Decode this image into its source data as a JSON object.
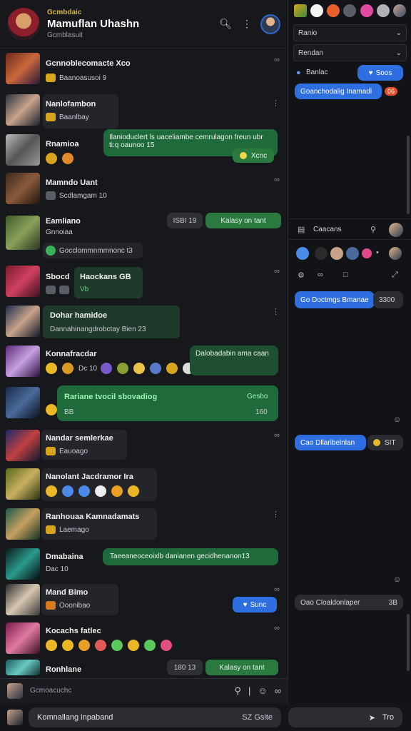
{
  "header": {
    "kicker": "Gcmbdaic",
    "title": "Mamuflan Uhashn",
    "subtitle": "Gcmblasuit",
    "search_icon": "search-icon",
    "more_icon": "more-icon"
  },
  "chats": [
    {
      "title": "Gcnnoblecomacte Xco",
      "sub": "Baanoasusoi 9",
      "badge": "gold"
    },
    {
      "title": "Nanlofambon",
      "sub": "Baanlbay",
      "badge": "gold"
    },
    {
      "title": "Rnamioa",
      "bubble": "Ilanioduclert ls uaceliambe cemrulagon freun ubr ti:q oaunoo 15",
      "pill": "Xcnc"
    },
    {
      "title": "Mamndo Uant",
      "sub": "Scdlamgam 10"
    },
    {
      "title": "Eamliano",
      "sub": "Gnnoiaa",
      "time": "ISBI 19",
      "pill": "Kalasy on tant",
      "sub2": "Gocclommnmmnonc t3"
    },
    {
      "title": "Sbocd",
      "card_title": "Haockans GB",
      "card_sub": "Vb"
    },
    {
      "title": "Dohar hamidoe",
      "sub": "Dannahinangdrobctay Bien 23"
    },
    {
      "title": "Konnafracdar",
      "sub": "Dc 10",
      "bubble": "Dalobadabin ama caan"
    },
    {
      "title": "Rariane tvocil sbovadiog",
      "bubble_right": "Gesbo",
      "sub": "BB",
      "time": "160"
    },
    {
      "title": "Nandar semlerkae",
      "sub": "Eauoago"
    },
    {
      "title": "Nanolant Jacdramor Ira",
      "sub": ""
    },
    {
      "title": "Ranhouaa Kamnadamats",
      "sub": "Laemago"
    },
    {
      "title": "Dmabaina",
      "sub": "Dac 10",
      "bubble": "Taeeaneoceoixlb danianen gecidhenanon13"
    },
    {
      "title": "Mand Bimo",
      "sub": "Ooonibao",
      "pill": "Sunc"
    },
    {
      "title": "Kocachs fatlec",
      "sub": ""
    },
    {
      "title": "Ronhlane",
      "time": "180 13",
      "pill": "Kalasy on tant"
    }
  ],
  "composer": {
    "placeholder": "Gcmoacuchc",
    "message": "Komnallang inpaband",
    "char_count": "SZ Gsite",
    "right_hint": "Tro"
  },
  "right": {
    "select1": "Ranio",
    "select2": "Rendan",
    "status_label": "Banlac",
    "status_pill": "Soos",
    "message1": "Goanchodalig Inamadl",
    "badge1": "06",
    "section_label": "Caacans",
    "message2": "Go Doctmgs Bmanae",
    "time2": "3300",
    "message3": "Cao Dllaribelnlan",
    "time3": "SIT",
    "message4": "Oao Cloaldonlaper",
    "time4": "3B"
  },
  "colors": {
    "accent_blue": "#2e6ee0",
    "accent_green": "#1f6a3a",
    "gold": "#d9a51f"
  }
}
